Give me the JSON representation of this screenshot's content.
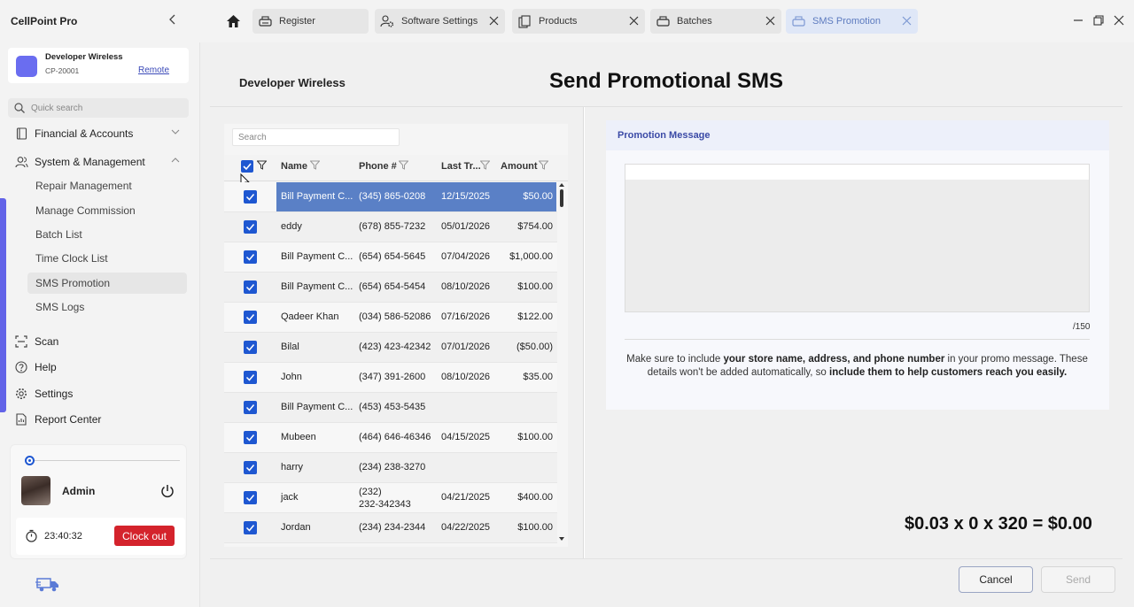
{
  "app": {
    "title": "CellPoint Pro"
  },
  "store": {
    "name": "Developer Wireless",
    "id": "CP-20001",
    "remote_label": "Remote"
  },
  "sidebar": {
    "search_placeholder": "Quick search",
    "groups": [
      {
        "label": "Financial & Accounts",
        "icon": "ledger-icon",
        "expanded": false
      },
      {
        "label": "System & Management",
        "icon": "people-icon",
        "expanded": true
      }
    ],
    "sub_items": [
      {
        "label": "Repair Management",
        "active": false
      },
      {
        "label": "Manage Commission",
        "active": false
      },
      {
        "label": "Batch List",
        "active": false
      },
      {
        "label": "Time Clock List",
        "active": false
      },
      {
        "label": "SMS Promotion",
        "active": true
      },
      {
        "label": "SMS Logs",
        "active": false
      }
    ],
    "items": [
      {
        "label": "Scan",
        "icon": "scan-icon"
      },
      {
        "label": "Help",
        "icon": "help-icon"
      },
      {
        "label": "Settings",
        "icon": "gear-icon"
      },
      {
        "label": "Report Center",
        "icon": "report-icon"
      }
    ],
    "user": {
      "name": "Admin",
      "timer": "23:40:32",
      "clock_out_label": "Clock out"
    }
  },
  "tabs": [
    {
      "label": "Register",
      "icon": "register-icon",
      "active": false
    },
    {
      "label": "Software Settings",
      "icon": "software-settings-icon",
      "active": false
    },
    {
      "label": "Products",
      "icon": "products-icon",
      "active": false
    },
    {
      "label": "Batches",
      "icon": "batches-icon",
      "active": false
    },
    {
      "label": "SMS Promotion",
      "icon": "sms-icon",
      "active": true
    }
  ],
  "page": {
    "store_title": "Developer Wireless",
    "title": "Send Promotional SMS"
  },
  "grid": {
    "search_placeholder": "Search",
    "columns": [
      "Name",
      "Phone #",
      "Last Tr...",
      "Amount"
    ],
    "rows": [
      {
        "name": "Bill Payment C...",
        "phone": "(345) 865-0208",
        "last": "12/15/2025",
        "amount": "$50.00",
        "checked": true,
        "selected": true
      },
      {
        "name": "eddy",
        "phone": "(678) 855-7232",
        "last": "05/01/2026",
        "amount": "$754.00",
        "checked": true,
        "selected": false
      },
      {
        "name": "Bill Payment C...",
        "phone": "(654) 654-5645",
        "last": "07/04/2026",
        "amount": "$1,000.00",
        "checked": true,
        "selected": false
      },
      {
        "name": "Bill Payment C...",
        "phone": "(654) 654-5454",
        "last": "08/10/2026",
        "amount": "$100.00",
        "checked": true,
        "selected": false
      },
      {
        "name": "Qadeer Khan",
        "phone": "(034) 586-52086",
        "last": "07/16/2026",
        "amount": "$122.00",
        "checked": true,
        "selected": false
      },
      {
        "name": "Bilal",
        "phone": "(423) 423-42342",
        "last": "07/01/2026",
        "amount": "($50.00)",
        "checked": true,
        "selected": false
      },
      {
        "name": "John",
        "phone": "(347) 391-2600",
        "last": "08/10/2026",
        "amount": "$35.00",
        "checked": true,
        "selected": false
      },
      {
        "name": "Bill Payment C...",
        "phone": "(453) 453-5435",
        "last": "",
        "amount": "",
        "checked": true,
        "selected": false
      },
      {
        "name": "Mubeen",
        "phone": "(464) 646-46346",
        "last": "04/15/2025",
        "amount": "$100.00",
        "checked": true,
        "selected": false
      },
      {
        "name": "harry",
        "phone": "(234) 238-3270",
        "last": "",
        "amount": "",
        "checked": true,
        "selected": false
      },
      {
        "name": "jack",
        "phone": "(232)\n232-342343",
        "last": "04/21/2025",
        "amount": "$400.00",
        "checked": true,
        "selected": false
      },
      {
        "name": "Jordan",
        "phone": "(234) 234-2344",
        "last": "04/22/2025",
        "amount": "$100.00",
        "checked": true,
        "selected": false
      }
    ]
  },
  "promo": {
    "title": "Promotion Message",
    "message": "",
    "char_count": "/150",
    "note_part1": "Make sure to include ",
    "note_bold1": "your store name, address, and phone number",
    "note_part2": " in your promo message. These details won't be added automatically, so ",
    "note_bold2": "include them to help customers reach you easily."
  },
  "cost": {
    "formula": "$0.03 x 0 x 320 = $0.00"
  },
  "actions": {
    "cancel_label": "Cancel",
    "send_label": "Send"
  },
  "colors": {
    "accent": "#6263e8",
    "checkbox": "#1e57d1",
    "selected_row": "#5a80c6",
    "clock_out": "#d4232c",
    "promo_title": "#3b4aa6"
  }
}
